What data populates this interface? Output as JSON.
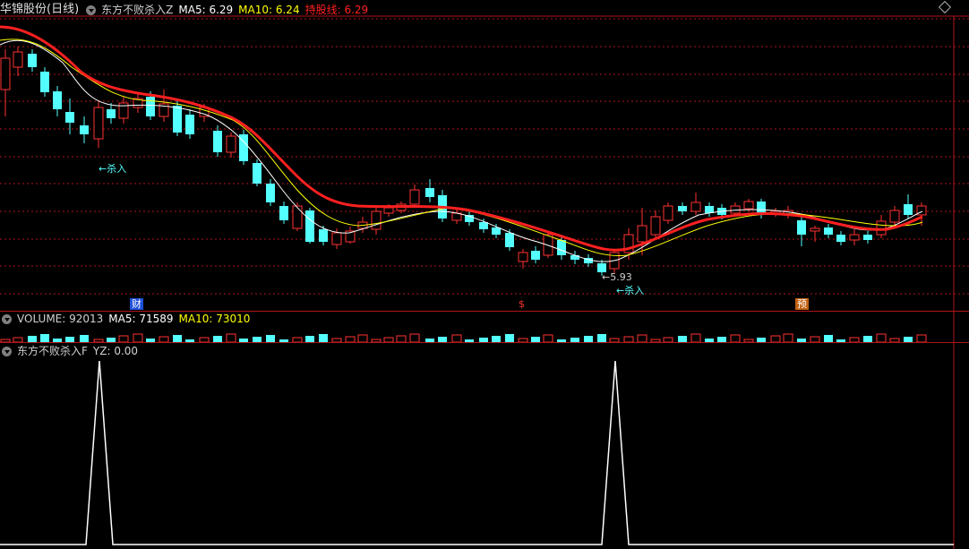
{
  "main": {
    "stock_title": "华锦股份(日线)",
    "indicator_name": "东方不败杀入Z",
    "ma5_label": "MA5: 6.29",
    "ma10_label": "MA10: 6.24",
    "hold_label": "持股线: 6.29",
    "annotations": {
      "kill_in_1": "←杀入",
      "low_price": "←5.93",
      "kill_in_2": "←杀入"
    },
    "markers": {
      "cai": "财",
      "s": "$",
      "yu": "预"
    }
  },
  "volume": {
    "volume_label": "VOLUME: 92013",
    "ma5_label": "MA5: 71589",
    "ma10_label": "MA10: 73010"
  },
  "indicator": {
    "title": "东方不败杀入F",
    "yz_label": "YZ: 0.00"
  },
  "colors": {
    "up": "#ff3232",
    "down": "#54ffff",
    "ma5": "#ffffff",
    "ma10": "#ffff00",
    "hold": "#ff2020",
    "grid": "#b0141a"
  },
  "icons": [
    "collapse-triangle-icon",
    "diamond-icon"
  ]
}
